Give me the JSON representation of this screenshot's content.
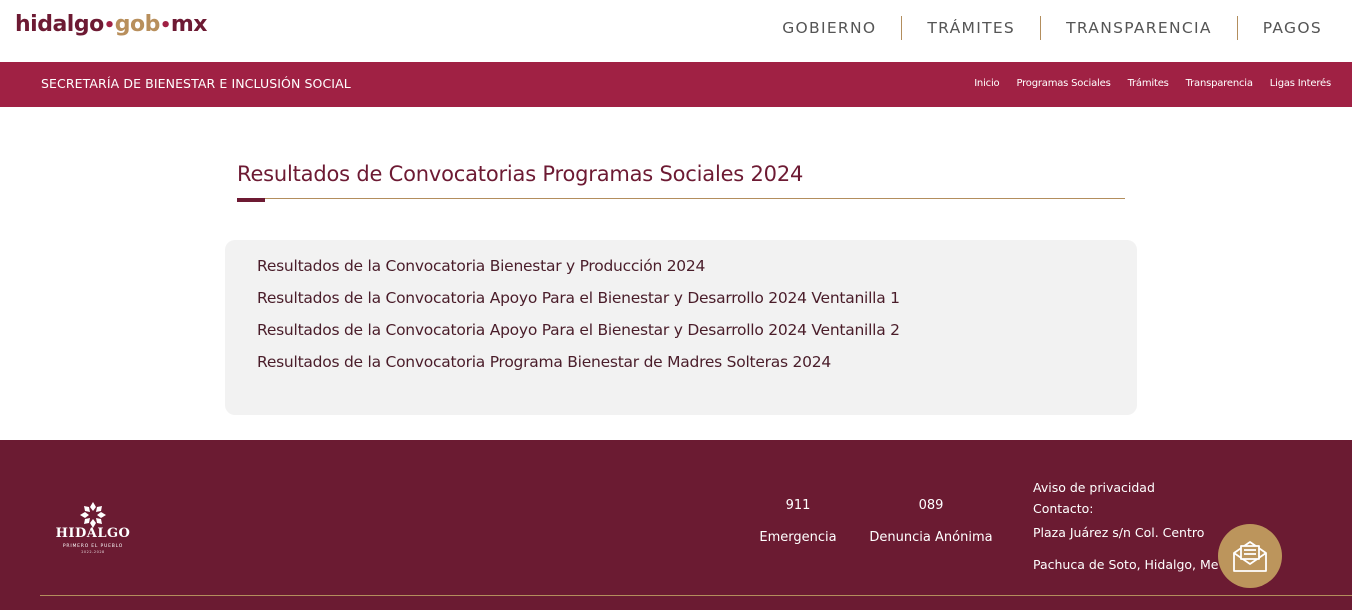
{
  "brand": {
    "logo_part1": "hidalgo",
    "logo_part2": "gob",
    "logo_part3": "mx",
    "dot": "•",
    "colors": {
      "maroon": "#6d1a33",
      "gold": "#b38e5d",
      "crimson": "#a02144",
      "footer": "#6b1b32"
    }
  },
  "top_nav": [
    "GOBIERNO",
    "TRÁMITES",
    "TRANSPARENCIA",
    "PAGOS"
  ],
  "secretaria": {
    "title": "SECRETARÍA DE BIENESTAR E INCLUSIÓN SOCIAL",
    "links": [
      "Inicio",
      "Programas Sociales",
      "Trámites",
      "Transparencia",
      "Ligas Interés"
    ]
  },
  "main": {
    "title": "Resultados de Convocatorias Programas Sociales 2024",
    "results": [
      "Resultados de la Convocatoria Bienestar y Producción 2024",
      "Resultados de la Convocatoria Apoyo Para el Bienestar y Desarrollo 2024 Ventanilla 1",
      "Resultados de la Convocatoria Apoyo Para el Bienestar y Desarrollo 2024 Ventanilla 2",
      "Resultados de la Convocatoria Programa Bienestar de Madres Solteras 2024"
    ]
  },
  "footer": {
    "logo_text": "HIDALGO",
    "logo_subtitle": "PRIMERO EL PUEBLO",
    "logo_years": "2022-2028",
    "phones": [
      {
        "number": "911",
        "label": "Emergencia"
      },
      {
        "number": "089",
        "label": "Denuncia Anónima"
      }
    ],
    "privacy": "Aviso de privacidad",
    "contact_label": "Contacto:",
    "address_line1": "Plaza Juárez s/n Col. Centro",
    "address_line2": "Pachuca de Soto, Hidalgo, Me"
  },
  "icons": {
    "chat": "envelope-chat-icon",
    "flower": "hidalgo-flower-icon"
  }
}
